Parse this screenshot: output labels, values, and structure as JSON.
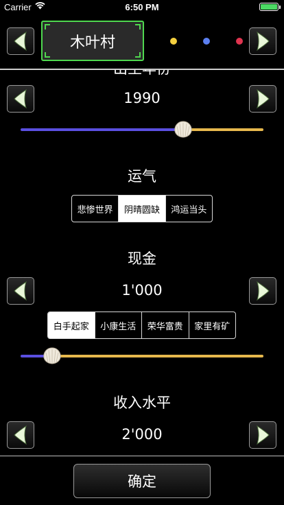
{
  "status_bar": {
    "carrier": "Carrier",
    "time": "6:50 PM"
  },
  "header": {
    "village_name": "木叶村",
    "partial_title": "出生年份",
    "dots": [
      {
        "name": "yellow",
        "color": "#f4d03f"
      },
      {
        "name": "blue",
        "color": "#5b7ff0"
      },
      {
        "name": "red",
        "color": "#e0344f"
      }
    ]
  },
  "year_section": {
    "value": "1990",
    "slider_fraction": 0.67
  },
  "luck_section": {
    "label": "运气",
    "options": [
      "悲惨世界",
      "阴晴圆缺",
      "鸿运当头"
    ],
    "selected_index": 1
  },
  "cash_section": {
    "label": "现金",
    "value": "1'000",
    "options": [
      "白手起家",
      "小康生活",
      "荣华富贵",
      "家里有矿"
    ],
    "selected_index": 0,
    "slider_fraction": 0.13
  },
  "income_section": {
    "label": "收入水平",
    "value": "2'000"
  },
  "confirm_label": "确定",
  "colors": {
    "accent_green": "#4fd84f",
    "slider_left": "#5a4fe0",
    "slider_right": "#e6b84d",
    "arrow_fill": "#e9f7d9"
  }
}
